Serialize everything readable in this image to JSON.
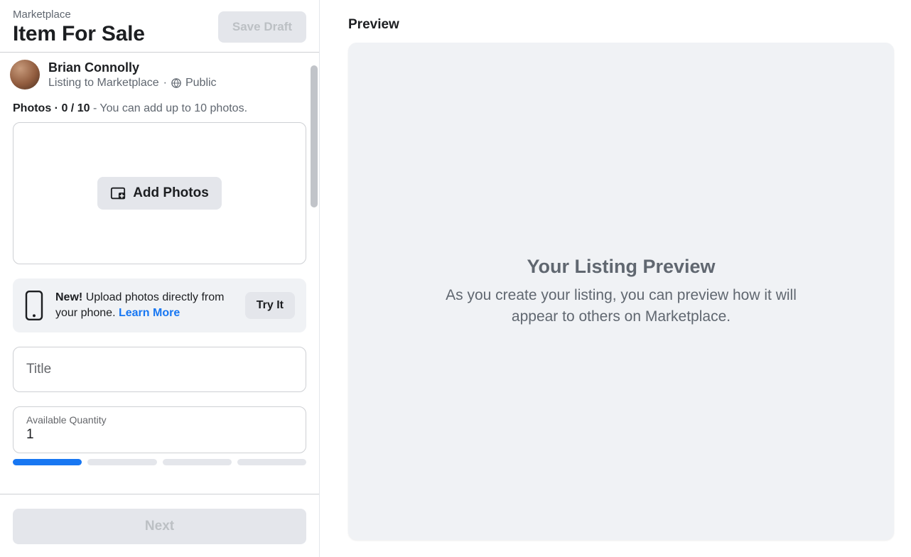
{
  "header": {
    "breadcrumb": "Marketplace",
    "title": "Item For Sale",
    "save_draft_label": "Save Draft"
  },
  "user": {
    "name": "Brian Connolly",
    "listing_to": "Listing to Marketplace",
    "separator": "·",
    "visibility": "Public"
  },
  "photos": {
    "label_prefix": "Photos",
    "count": "0 / 10",
    "hint": "You can add up to 10 photos.",
    "add_button": "Add Photos"
  },
  "promo": {
    "badge": "New!",
    "text": "Upload photos directly from your phone.",
    "learn_more": "Learn More",
    "try_it": "Try It"
  },
  "fields": {
    "title_placeholder": "Title",
    "quantity_label": "Available Quantity",
    "quantity_value": "1"
  },
  "footer": {
    "next_label": "Next"
  },
  "preview": {
    "section_title": "Preview",
    "heading": "Your Listing Preview",
    "description": "As you create your listing, you can preview how it will appear to others on Marketplace."
  }
}
